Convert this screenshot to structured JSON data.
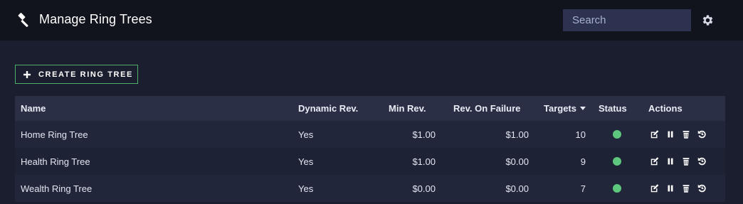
{
  "header": {
    "title": "Manage Ring Trees",
    "logo_icon": "gavel-icon",
    "search_placeholder": "Search",
    "settings_icon": "gear-icon"
  },
  "toolbar": {
    "create_label": "CREATE RING TREE",
    "create_icon": "plus-icon"
  },
  "table": {
    "columns": [
      "Name",
      "Dynamic Rev.",
      "Min Rev.",
      "Rev. On Failure",
      "Targets",
      "Status",
      "Actions"
    ],
    "sorted_column": "Targets",
    "sort_direction": "descending",
    "rows": [
      {
        "name": "Home Ring Tree",
        "dynamic_rev": "Yes",
        "min_rev": "$1.00",
        "rev_on_failure": "$1.00",
        "targets": "10",
        "status": "active"
      },
      {
        "name": "Health Ring Tree",
        "dynamic_rev": "Yes",
        "min_rev": "$1.00",
        "rev_on_failure": "$0.00",
        "targets": "9",
        "status": "active"
      },
      {
        "name": "Wealth Ring Tree",
        "dynamic_rev": "Yes",
        "min_rev": "$0.00",
        "rev_on_failure": "$0.00",
        "targets": "7",
        "status": "active"
      }
    ],
    "row_actions": [
      "edit-icon",
      "pause-icon",
      "delete-icon",
      "history-icon"
    ]
  },
  "colors": {
    "background": "#1b1e2e",
    "topbar": "#12141d",
    "accent_green": "#4caf6a",
    "status_active": "#5cc77d",
    "search_bg": "#2c3250"
  }
}
